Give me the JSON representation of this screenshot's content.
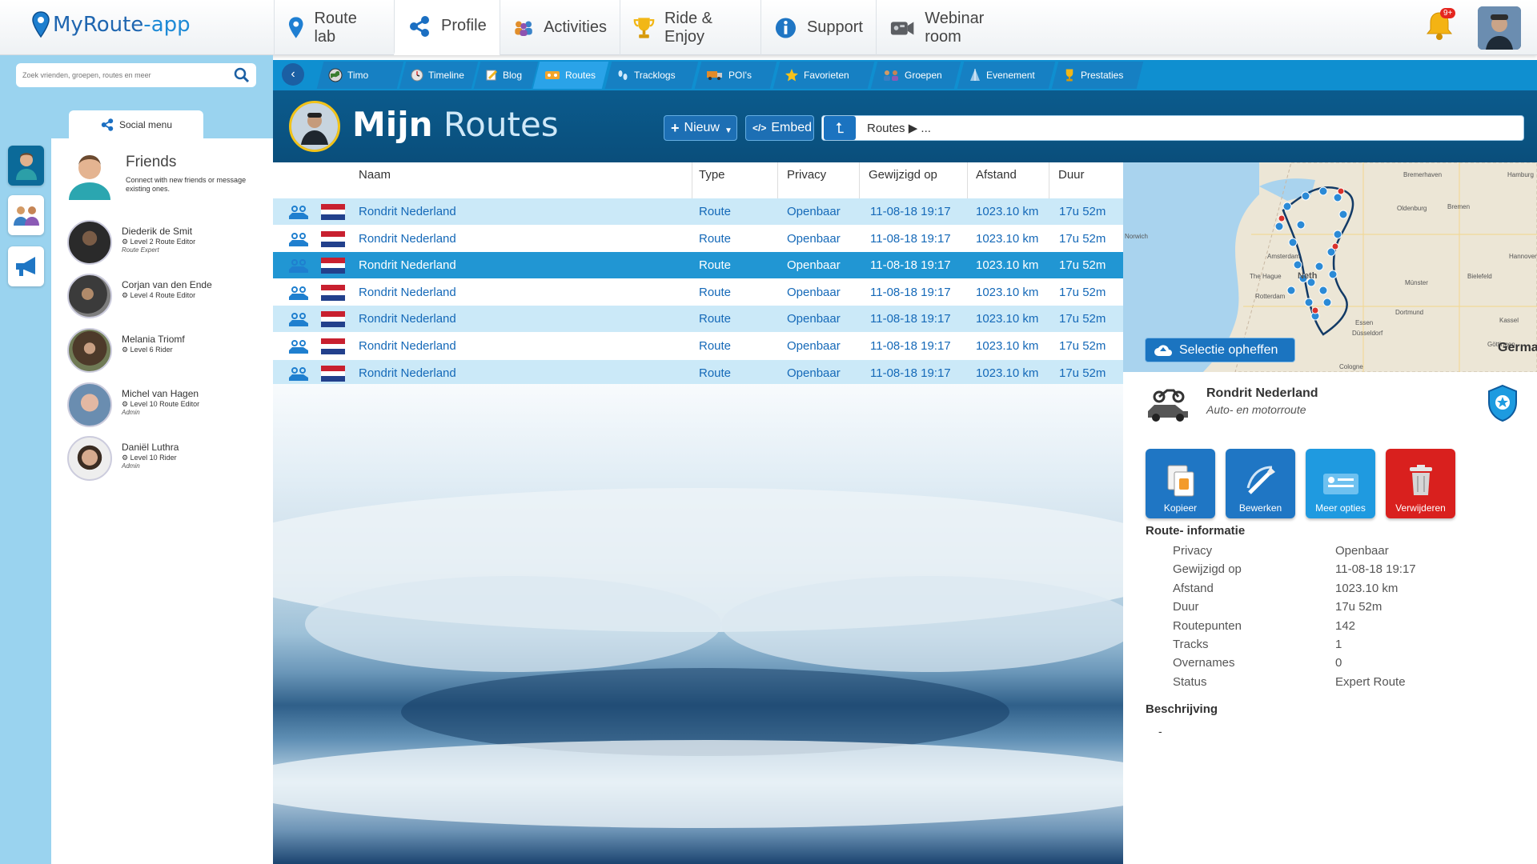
{
  "app": {
    "brand_main": "MyRoute",
    "brand_dash": "-",
    "brand_app": "app"
  },
  "nav": {
    "items": [
      {
        "label": "Route lab"
      },
      {
        "label": "Profile"
      },
      {
        "label": "Activities"
      },
      {
        "label": "Ride & Enjoy"
      },
      {
        "label": "Support"
      },
      {
        "label": "Webinar room"
      }
    ],
    "notification_badge": "9+"
  },
  "search": {
    "placeholder": "Zoek vrienden, groepen, routes en meer"
  },
  "social_menu": {
    "label": "Social menu"
  },
  "friends": {
    "title": "Friends",
    "subtitle": "Connect with new friends or message existing ones.",
    "list": [
      {
        "name": "Diederik de Smit",
        "level": "Level 2 Route Editor",
        "role": "Route Expert"
      },
      {
        "name": "Corjan van den Ende",
        "level": "Level 4 Route Editor",
        "role": ""
      },
      {
        "name": "Melania Triomf",
        "level": "Level 6 Rider",
        "role": ""
      },
      {
        "name": "Michel van Hagen",
        "level": "Level 10 Route Editor",
        "role": "Admin"
      },
      {
        "name": "Daniël Luthra",
        "level": "Level 10 Rider",
        "role": "Admin"
      }
    ]
  },
  "subtabs": [
    "Timo",
    "Timeline",
    "Blog",
    "Routes",
    "Tracklogs",
    "POI's",
    "Favorieten",
    "Groepen",
    "Evenement",
    "Prestaties"
  ],
  "header": {
    "title_bold": "Mijn",
    "title_light": "Routes",
    "new_button": "Nieuw",
    "embed_button": "Embed",
    "breadcrumb": "Routes ▶ ..."
  },
  "table": {
    "columns": [
      "Naam",
      "Type",
      "Privacy",
      "Gewijzigd op",
      "Afstand",
      "Duur"
    ],
    "rows": [
      {
        "name": "Rondrit Nederland",
        "type": "Route",
        "privacy": "Openbaar",
        "modified": "11-08-18 19:17",
        "distance": "1023.10 km",
        "duration": "17u 52m"
      },
      {
        "name": "Rondrit Nederland",
        "type": "Route",
        "privacy": "Openbaar",
        "modified": "11-08-18 19:17",
        "distance": "1023.10 km",
        "duration": "17u 52m"
      },
      {
        "name": "Rondrit Nederland",
        "type": "Route",
        "privacy": "Openbaar",
        "modified": "11-08-18 19:17",
        "distance": "1023.10 km",
        "duration": "17u 52m"
      },
      {
        "name": "Rondrit Nederland",
        "type": "Route",
        "privacy": "Openbaar",
        "modified": "11-08-18 19:17",
        "distance": "1023.10 km",
        "duration": "17u 52m"
      },
      {
        "name": "Rondrit Nederland",
        "type": "Route",
        "privacy": "Openbaar",
        "modified": "11-08-18 19:17",
        "distance": "1023.10 km",
        "duration": "17u 52m"
      },
      {
        "name": "Rondrit Nederland",
        "type": "Route",
        "privacy": "Openbaar",
        "modified": "11-08-18 19:17",
        "distance": "1023.10 km",
        "duration": "17u 52m"
      },
      {
        "name": "Rondrit Nederland",
        "type": "Route",
        "privacy": "Openbaar",
        "modified": "11-08-18 19:17",
        "distance": "1023.10 km",
        "duration": "17u 52m"
      }
    ],
    "selected_index": 2
  },
  "map": {
    "labels": [
      "Bremerhaven",
      "Hamburg",
      "Oldenburg",
      "Bremen",
      "Amsterdam",
      "Hannover",
      "The Hague",
      "Neth",
      "Münster",
      "Bielefeld",
      "Rotterdam",
      "Kassel",
      "Essen",
      "Düsseldorf",
      "Dortmund",
      "Göttingen",
      "Norwich",
      "Cologne",
      "German"
    ]
  },
  "detail": {
    "deselect_button": "Selectie opheffen",
    "route_name": "Rondrit Nederland",
    "route_type": "Auto- en motorroute",
    "actions": [
      {
        "label": "Kopieer",
        "color": "#1f76c4"
      },
      {
        "label": "Bewerken",
        "color": "#1f76c4"
      },
      {
        "label": "Meer opties",
        "color": "#1f9ae0"
      },
      {
        "label": "Verwijderen",
        "color": "#d9201e"
      }
    ],
    "info_title": "Route- informatie",
    "info": [
      {
        "key": "Privacy",
        "value": "Openbaar"
      },
      {
        "key": "Gewijzigd op",
        "value": "11-08-18 19:17"
      },
      {
        "key": "Afstand",
        "value": "1023.10 km"
      },
      {
        "key": "Duur",
        "value": "17u 52m"
      },
      {
        "key": "Routepunten",
        "value": "142"
      },
      {
        "key": "Tracks",
        "value": "1"
      },
      {
        "key": "Overnames",
        "value": "0"
      },
      {
        "key": "Status",
        "value": "Expert Route"
      }
    ],
    "description_title": "Beschrijving",
    "description": "-"
  }
}
